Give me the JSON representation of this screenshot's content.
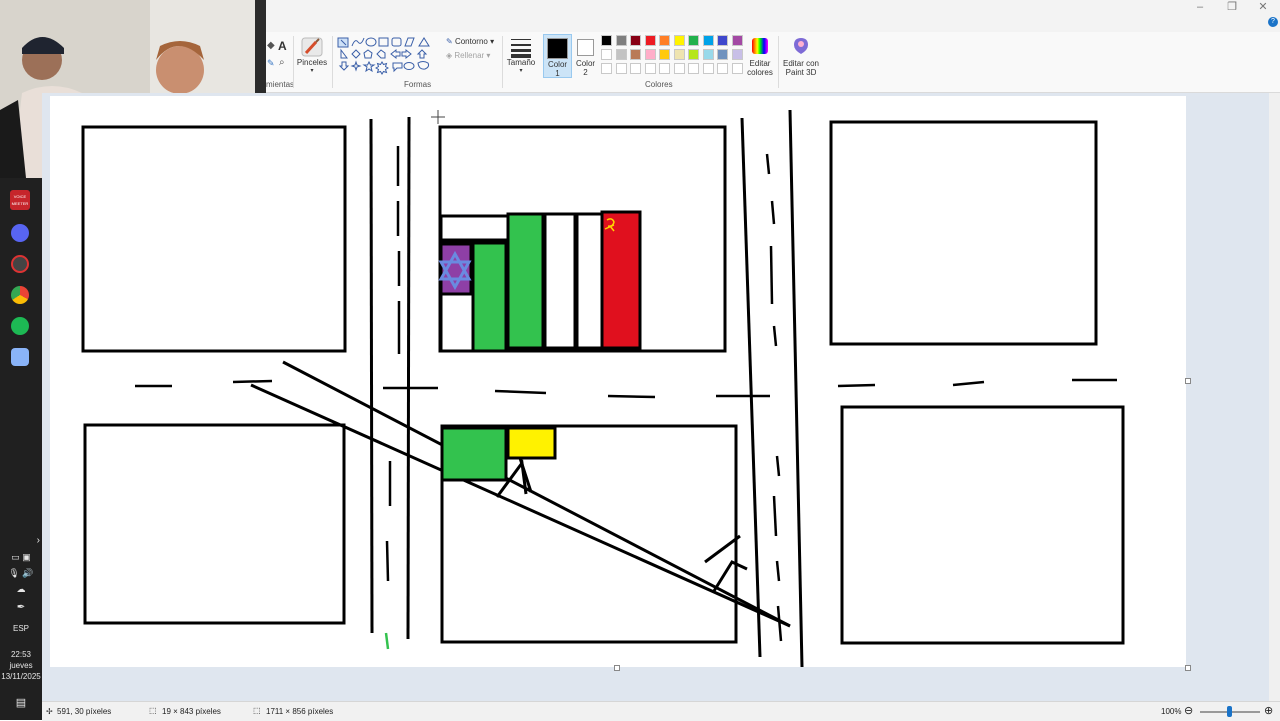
{
  "ribbon": {
    "tools_group_label": "mientas",
    "brushes_label": "Pinceles",
    "shapes_group_label": "Formas",
    "outline_label": "Contorno",
    "fill_label": "Rellenar",
    "size_label": "Tamaño",
    "color1_label": "Color\n1",
    "color1_label_a": "Color",
    "color1_label_b": "1",
    "color2_label_a": "Color",
    "color2_label_b": "2",
    "colors_group_label": "Colores",
    "edit_colors_a": "Editar",
    "edit_colors_b": "colores",
    "paint3d_a": "Editar con",
    "paint3d_b": "Paint 3D",
    "text_tool_glyph": "A"
  },
  "palette": {
    "row1": [
      "#000000",
      "#7f7f7f",
      "#880015",
      "#ed1c24",
      "#ff7f27",
      "#fff200",
      "#22b14c",
      "#00a2e8",
      "#3f48cc",
      "#a349a4"
    ],
    "row2": [
      "#ffffff",
      "#c3c3c3",
      "#b97a57",
      "#ffaec9",
      "#ffc90e",
      "#efe4b0",
      "#b5e61d",
      "#99d9ea",
      "#7092be",
      "#c8bfe7"
    ],
    "row3": [
      "#ffffff",
      "#ffffff",
      "#ffffff",
      "#ffffff",
      "#ffffff",
      "#ffffff",
      "#ffffff",
      "#ffffff",
      "#ffffff",
      "#ffffff"
    ],
    "color1": "#000000",
    "color2": "#ffffff"
  },
  "drawing_colors": {
    "green": "#33c24e",
    "white": "#ffffff",
    "red": "#e0101e",
    "purple": "#8e3fa6",
    "star": "#6a8ae0",
    "yellow": "#fff200",
    "emblem": "#ffd400"
  },
  "status": {
    "cursor_pos": "591, 30 píxeles",
    "selection_size": "19 × 843 píxeles",
    "image_size": "1711 × 856 píxeles",
    "zoom": "100%"
  },
  "taskbar": {
    "lang": "ESP",
    "time": "22:53",
    "day": "jueves",
    "date": "13/11/2025",
    "vm_label": "VOICE MEETER",
    "chevron": "›"
  },
  "icons": {
    "brush": "paintbrush-icon",
    "shapes": "shapes-gallery-icon",
    "size": "line-size-icon",
    "edit_colors": "color-wheel-icon",
    "paint3d": "paint3d-icon"
  }
}
